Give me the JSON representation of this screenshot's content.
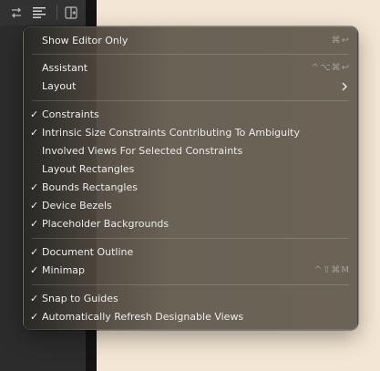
{
  "menu": {
    "show_editor_only": {
      "label": "Show Editor Only",
      "shortcut": "⌘↩"
    },
    "assistant": {
      "label": "Assistant",
      "shortcut": "^⌥⌘↩"
    },
    "layout": {
      "label": "Layout"
    },
    "constraints": {
      "label": "Constraints",
      "checked": true
    },
    "intrinsic": {
      "label": "Intrinsic Size Constraints Contributing To Ambiguity",
      "checked": true
    },
    "involved_views": {
      "label": "Involved Views For Selected Constraints",
      "checked": false
    },
    "layout_rectangles": {
      "label": "Layout Rectangles",
      "checked": false
    },
    "bounds_rectangles": {
      "label": "Bounds Rectangles",
      "checked": true
    },
    "device_bezels": {
      "label": "Device Bezels",
      "checked": true
    },
    "placeholder_backgrounds": {
      "label": "Placeholder Backgrounds",
      "checked": true
    },
    "document_outline": {
      "label": "Document Outline",
      "checked": true
    },
    "minimap": {
      "label": "Minimap",
      "checked": true,
      "shortcut": "^⇧⌘M"
    },
    "snap_to_guides": {
      "label": "Snap to Guides",
      "checked": true
    },
    "auto_refresh": {
      "label": "Automatically Refresh Designable Views",
      "checked": true
    }
  },
  "check_glyph": "✓",
  "colors": {
    "canvas": "#f3e6d4",
    "panel": "#2c2c2d",
    "menu_text": "#ececec"
  }
}
